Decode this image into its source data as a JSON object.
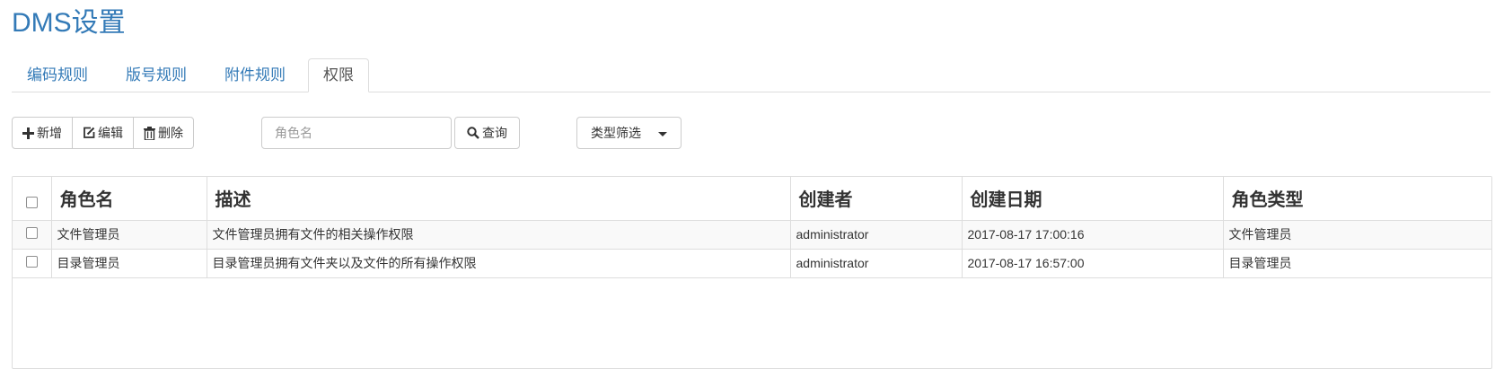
{
  "page": {
    "title": "DMS设置"
  },
  "tabs": [
    {
      "label": "编码规则",
      "active": false
    },
    {
      "label": "版号规则",
      "active": false
    },
    {
      "label": "附件规则",
      "active": false
    },
    {
      "label": "权限",
      "active": true
    }
  ],
  "toolbar": {
    "add_label": "新增",
    "edit_label": "编辑",
    "delete_label": "删除",
    "search_placeholder": "角色名",
    "search_value": "",
    "query_label": "查询",
    "filter_label": "类型筛选"
  },
  "table": {
    "columns": [
      "角色名",
      "描述",
      "创建者",
      "创建日期",
      "角色类型"
    ],
    "rows": [
      {
        "name": "文件管理员",
        "description": "文件管理员拥有文件的相关操作权限",
        "creator": "administrator",
        "created": "2017-08-17 17:00:16",
        "type": "文件管理员",
        "checked": false
      },
      {
        "name": "目录管理员",
        "description": "目录管理员拥有文件夹以及文件的所有操作权限",
        "creator": "administrator",
        "created": "2017-08-17 16:57:00",
        "type": "目录管理员",
        "checked": false
      }
    ]
  },
  "colors": {
    "link": "#337ab7",
    "border": "#dddddd",
    "stripe": "#f9f9f9"
  },
  "icons": {
    "add": "plus-icon",
    "edit": "edit-icon",
    "delete": "trash-icon",
    "query": "search-icon",
    "filter": "caret-down-icon"
  }
}
